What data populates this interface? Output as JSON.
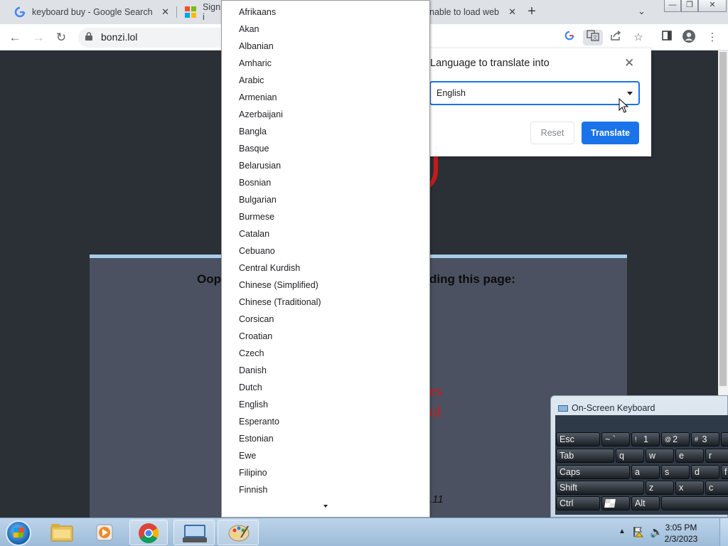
{
  "browser": {
    "tabs": [
      {
        "title": "keyboard buy - Google Search",
        "favicon": "google-g"
      },
      {
        "title": "Sign i",
        "favicon": "microsoft-logo"
      },
      {
        "title": "nable to load web",
        "favicon": "page"
      }
    ],
    "url": "bonzi.lol",
    "new_tab_glyph": "+",
    "tab_search_glyph": "⌄",
    "window_buttons": {
      "minimize": "—",
      "maximize": "❐",
      "close": "✕"
    }
  },
  "page": {
    "error_left": "Oop",
    "error_right": "ding this page:",
    "red_line1": "es",
    "red_line2": "ol",
    "version_fragment": ".11"
  },
  "translate_bubble": {
    "title": "Language to translate into",
    "selected_language": "English",
    "reset_label": "Reset",
    "translate_label": "Translate",
    "close_glyph": "✕"
  },
  "language_dropdown": {
    "items": [
      "Afrikaans",
      "Akan",
      "Albanian",
      "Amharic",
      "Arabic",
      "Armenian",
      "Azerbaijani",
      "Bangla",
      "Basque",
      "Belarusian",
      "Bosnian",
      "Bulgarian",
      "Burmese",
      "Catalan",
      "Cebuano",
      "Central Kurdish",
      "Chinese (Simplified)",
      "Chinese (Traditional)",
      "Corsican",
      "Croatian",
      "Czech",
      "Danish",
      "Dutch",
      "English",
      "Esperanto",
      "Estonian",
      "Ewe",
      "Filipino",
      "Finnish"
    ]
  },
  "osk": {
    "title": "On-Screen Keyboard",
    "keys": {
      "esc": "Esc",
      "tilde": "~ `",
      "k1": "1",
      "k1_shift": "!",
      "k2": "2",
      "k2_shift": "@",
      "k3": "3",
      "k3_shift": "#",
      "tab": "Tab",
      "q": "q",
      "w": "w",
      "e": "e",
      "r": "r",
      "caps": "Caps",
      "a": "a",
      "s": "s",
      "d": "d",
      "f": "f",
      "shift": "Shift",
      "z": "z",
      "x": "x",
      "c": "c",
      "ctrl": "Ctrl",
      "alt": "Alt"
    }
  },
  "taskbar": {
    "time": "3:05 PM",
    "date": "2/3/2023",
    "apps": [
      "explorer",
      "media-player",
      "chrome",
      "on-screen-keyboard",
      "paint"
    ]
  },
  "colors": {
    "accent": "#1a73e8",
    "page_bg": "#2b2f36",
    "error_panel": "#4b5160",
    "error_red": "#d01818"
  }
}
